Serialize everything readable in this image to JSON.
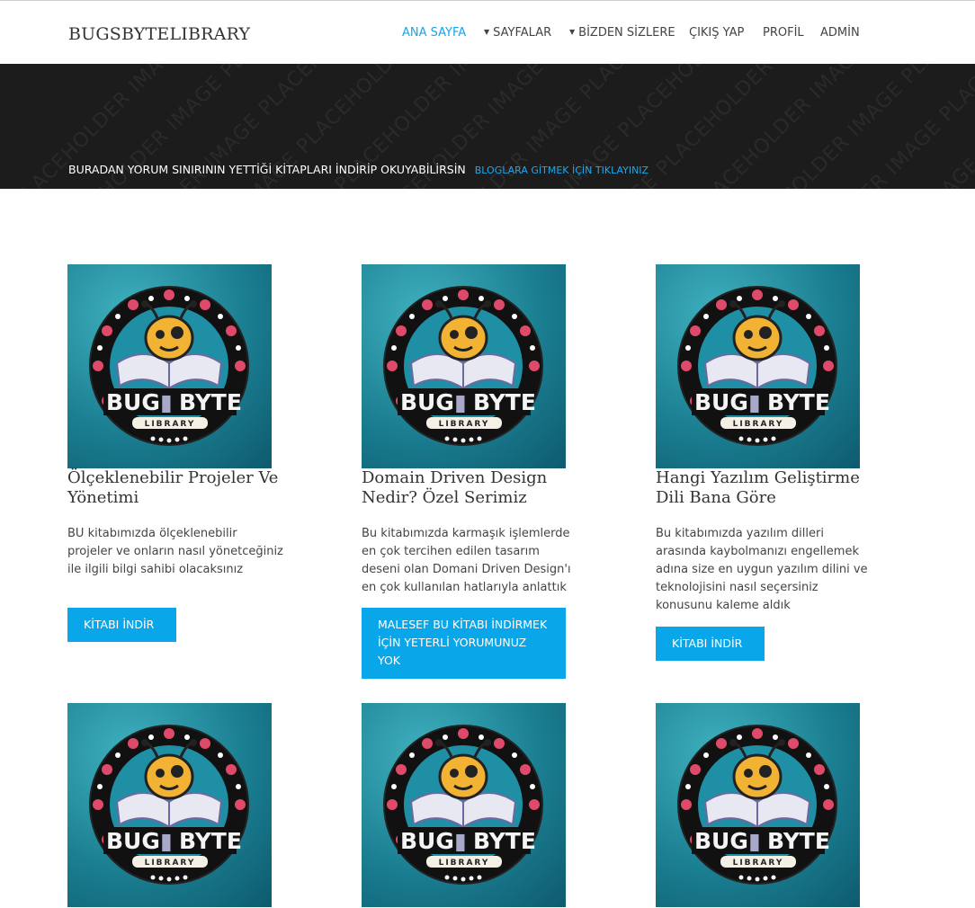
{
  "header": {
    "brand": "BUGSBYTELIBRARY",
    "nav": [
      {
        "label": "ANA SAYFA",
        "active": true,
        "dropdown": false
      },
      {
        "label": "SAYFALAR",
        "active": false,
        "dropdown": true
      },
      {
        "label": "BİZDEN SİZLERE",
        "active": false,
        "dropdown": true
      },
      {
        "label": "ÇIKIŞ YAP",
        "active": false,
        "dropdown": false
      },
      {
        "label": "PROFİL",
        "active": false,
        "dropdown": false
      },
      {
        "label": "ADMİN",
        "active": false,
        "dropdown": false
      }
    ]
  },
  "hero": {
    "watermark": "IMAGE PLACEHOLDER",
    "text": "BURADAN YORUM SINIRININ YETTİĞİ KİTAPLARI İNDİRİP OKUYABİLİRSİN",
    "link": "BLOGLARA GİTMEK İÇİN TIKLAYINIZ"
  },
  "logo": {
    "title_left": "BUG",
    "title_right": "BYTE",
    "subtitle": "LIBRARY"
  },
  "colors": {
    "accent": "#0aa6ea",
    "hero_bg": "#1c1c1c",
    "thumb_bg": "#1b7f92"
  },
  "books": [
    {
      "title": "Ölçeklenebilir Projeler Ve Yönetimi",
      "description": "BU kitabımızda ölçeklenebilir projeler ve onların nasıl yönetceğiniz ile ilgili bilgi sahibi olacaksınız",
      "button": "KİTABI İNDİR"
    },
    {
      "title": "Domain Driven Design Nedir? Özel Serimiz",
      "description": "Bu kitabımızda karmaşık işlemlerde en çok tercihen edilen tasarım deseni olan Domani Driven Design'ı en çok kullanılan hatlarıyla anlattık",
      "button": "MALESEF BU KİTABI İNDİRMEK İÇİN YETERLİ YORUMUNUZ YOK"
    },
    {
      "title": "Hangi Yazılım Geliştirme Dili Bana Göre",
      "description": "Bu kitabımızda yazılım dilleri arasında kaybolmanızı engellemek adına size en uygun yazılım dilini ve teknolojisini nasıl seçersiniz konusunu kaleme aldık",
      "button": "KİTABI İNDİR"
    }
  ]
}
